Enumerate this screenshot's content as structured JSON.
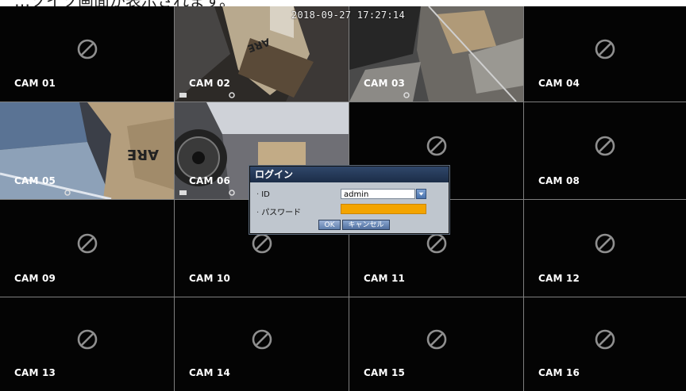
{
  "caption": "…ソイソ画面が表示されます。",
  "timestamp": "2018-09-27 17:27:14",
  "cameras": [
    {
      "label": "CAM 01",
      "has_video": false
    },
    {
      "label": "CAM 02",
      "has_video": true
    },
    {
      "label": "CAM 03",
      "has_video": true
    },
    {
      "label": "CAM 04",
      "has_video": false
    },
    {
      "label": "CAM 05",
      "has_video": true
    },
    {
      "label": "CAM 06",
      "has_video": true
    },
    {
      "label": "CAM 07",
      "has_video": false
    },
    {
      "label": "CAM 08",
      "has_video": false
    },
    {
      "label": "CAM 09",
      "has_video": false
    },
    {
      "label": "CAM 10",
      "has_video": false
    },
    {
      "label": "CAM 11",
      "has_video": false
    },
    {
      "label": "CAM 12",
      "has_video": false
    },
    {
      "label": "CAM 13",
      "has_video": false
    },
    {
      "label": "CAM 14",
      "has_video": false
    },
    {
      "label": "CAM 15",
      "has_video": false
    },
    {
      "label": "CAM 16",
      "has_video": false
    }
  ],
  "login": {
    "title": "ログイン",
    "id_label": "ID",
    "id_value": "admin",
    "password_label": "パスワード",
    "password_value": "",
    "ok_label": "OK",
    "cancel_label": "キャンセル",
    "password_field_color": "#f3a400"
  },
  "colors": {
    "tile_bg": "#040404",
    "grid_line": "#7f7f7f",
    "dialog_title_bg": "#30476a"
  }
}
